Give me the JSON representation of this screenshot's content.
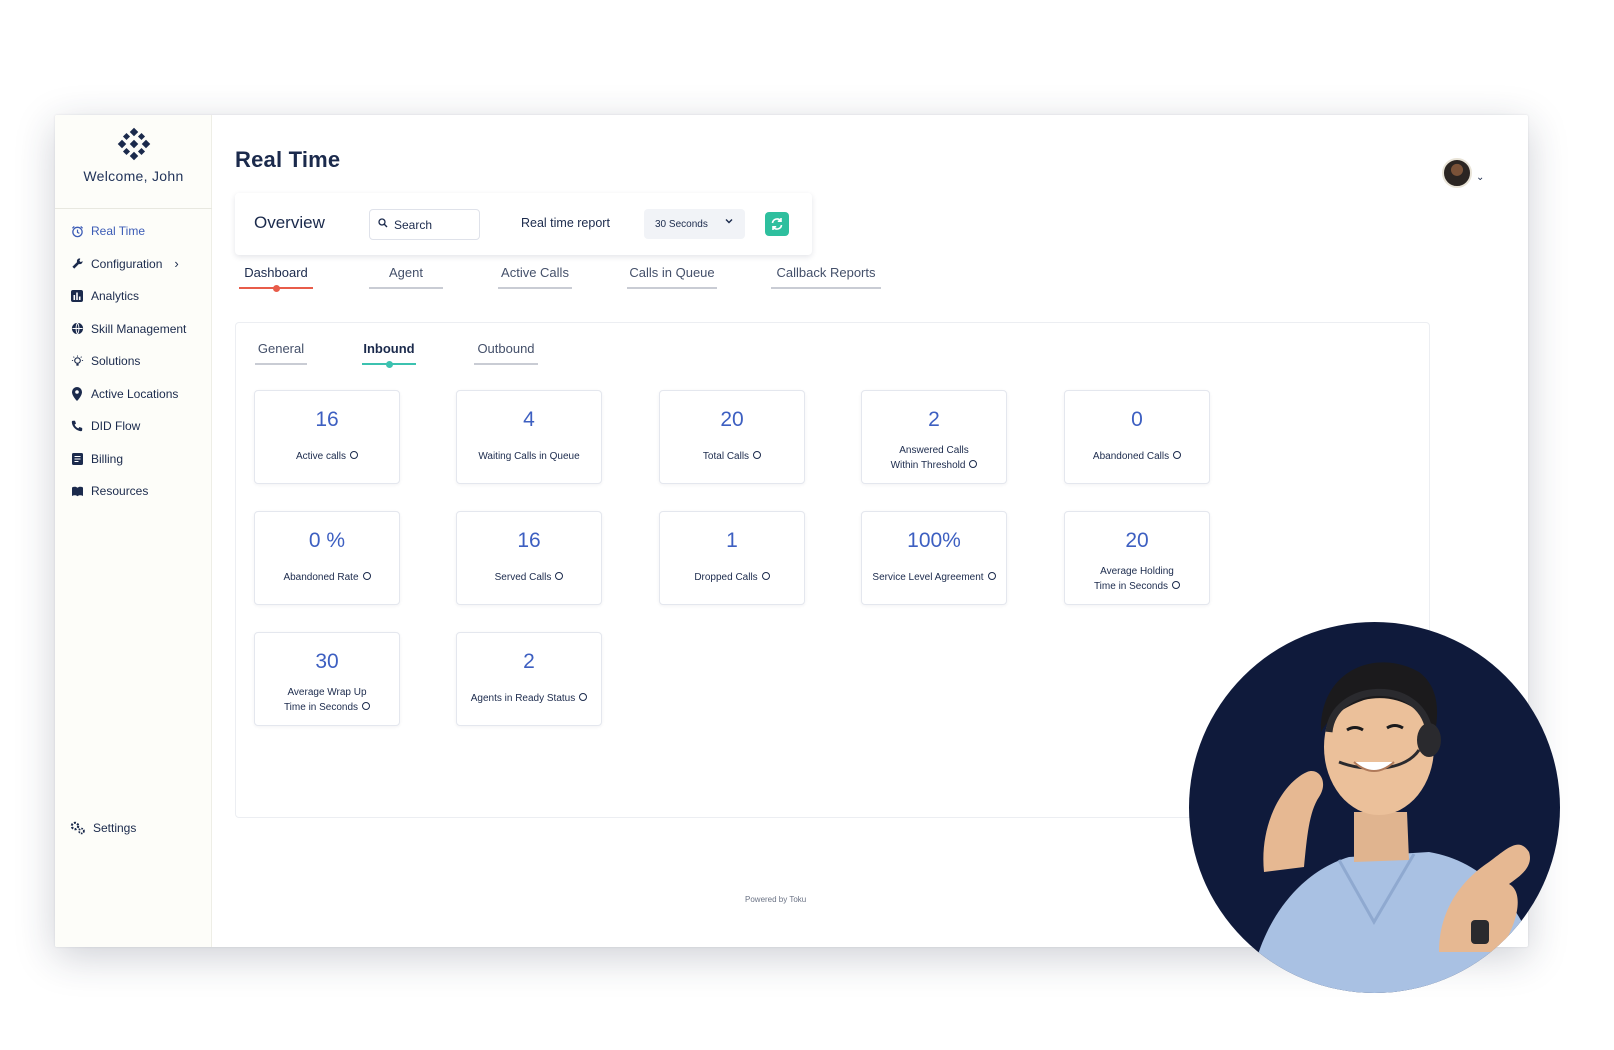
{
  "sidebar": {
    "welcome": "Welcome, John",
    "items": [
      {
        "label": "Real Time",
        "icon": "alarm-clock-icon",
        "active": true
      },
      {
        "label": "Configuration",
        "icon": "wrench-icon",
        "has_submenu": true
      },
      {
        "label": "Analytics",
        "icon": "bar-chart-icon"
      },
      {
        "label": "Skill Management",
        "icon": "globe-icon"
      },
      {
        "label": "Solutions",
        "icon": "lightbulb-icon"
      },
      {
        "label": "Active Locations",
        "icon": "location-pin-icon"
      },
      {
        "label": "DID Flow",
        "icon": "phone-icon"
      },
      {
        "label": "Billing",
        "icon": "receipt-icon"
      },
      {
        "label": "Resources",
        "icon": "book-icon"
      }
    ],
    "settings_label": "Settings"
  },
  "header": {
    "title": "Real Time"
  },
  "overview": {
    "title": "Overview",
    "search_placeholder": "Search",
    "report_label": "Real time report",
    "report_interval": "30 Seconds"
  },
  "tabs": [
    {
      "label": "Dashboard",
      "active": true
    },
    {
      "label": "Agent"
    },
    {
      "label": "Active Calls"
    },
    {
      "label": "Calls in Queue"
    },
    {
      "label": "Callback Reports"
    }
  ],
  "subtabs": [
    {
      "label": "General"
    },
    {
      "label": "Inbound",
      "active": true
    },
    {
      "label": "Outbound"
    }
  ],
  "metrics": [
    {
      "value": "16",
      "label": "Active calls"
    },
    {
      "value": "4",
      "label": "Waiting Calls in Queue"
    },
    {
      "value": "20",
      "label": "Total Calls"
    },
    {
      "value": "2",
      "label_line1": "Answered Calls",
      "label_line2": "Within Threshold"
    },
    {
      "value": "0",
      "label": "Abandoned Calls"
    },
    {
      "value": "0 %",
      "label": "Abandoned Rate"
    },
    {
      "value": "16",
      "label": "Served Calls"
    },
    {
      "value": "1",
      "label": "Dropped Calls"
    },
    {
      "value": "100%",
      "label": "Service Level Agreement"
    },
    {
      "value": "20",
      "label_line1": "Average Holding",
      "label_line2": "Time in Seconds"
    },
    {
      "value": "30",
      "label_line1": "Average Wrap Up",
      "label_line2": "Time in Seconds"
    },
    {
      "value": "2",
      "label": "Agents in Ready Status"
    }
  ],
  "footer": "Powered by Toku",
  "colors": {
    "accent_blue": "#3d5fc1",
    "navy": "#1b2a4c",
    "active_tab_underline": "#e85c4a",
    "subtab_underline": "#3cc2b0",
    "refresh_button": "#2ebf9e",
    "photo_background": "#0f1a3b"
  }
}
